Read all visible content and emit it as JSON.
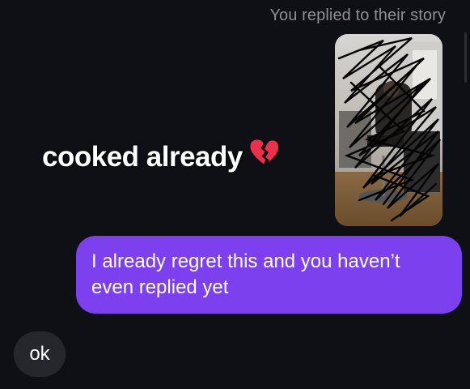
{
  "thread": {
    "story_reply_caption": "You replied to their story",
    "story_overlay_text": "cooked already",
    "story_overlay_emoji": "broken-heart-icon",
    "sent_message": "I already regret this and you haven’t even replied yet",
    "received_message": "ok"
  },
  "colors": {
    "background": "#0f1015",
    "sent_bubble": "#7c40ef",
    "received_bubble": "#26272c",
    "caption_text": "#8d8f96",
    "broken_heart": "#e8314b"
  }
}
